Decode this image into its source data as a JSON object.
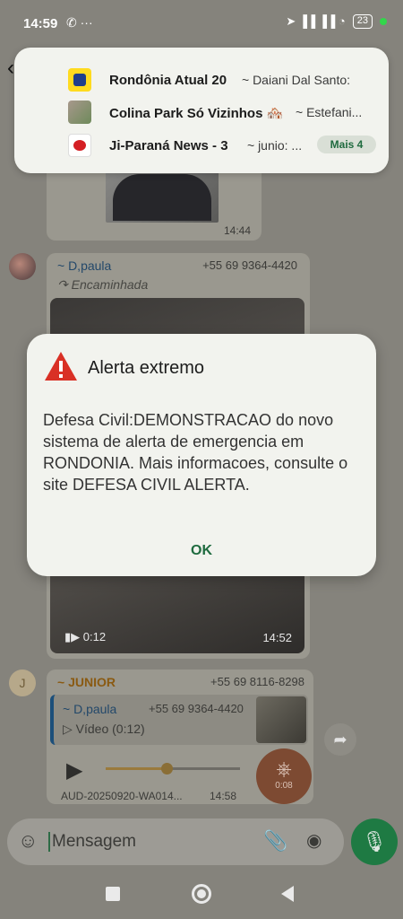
{
  "status_bar": {
    "time": "14:59",
    "left_icons": "✆ ···",
    "signal_icons": "➤ ▐▐ ▐▐ ◔",
    "battery": "23"
  },
  "notifications": [
    {
      "title": "Rondônia Atual  20",
      "snippet": "~ Daiani Dal Santo:"
    },
    {
      "title": "Colina Park Só Vizinhos 🏘️",
      "snippet": "~ Estefani..."
    },
    {
      "title": "Ji-Paraná News - 3",
      "snippet": "~ junio: ..."
    }
  ],
  "more_label": "Mais 4",
  "messages": {
    "image_time": "14:44",
    "video": {
      "sender": "~ D,paula",
      "phone": "+55 69 9364-4420",
      "forwarded": "↷ Encaminhada",
      "duration": "0:12",
      "time": "14:52"
    },
    "audio": {
      "avatar_letter": "J",
      "sender": "~ JUNIOR",
      "phone": "+55 69 8116-8298",
      "quote_name": "~ D,paula",
      "quote_phone": "+55 69 9364-4420",
      "quote_text": "Vídeo (0:12)",
      "filename": "AUD-20250920-WA014...",
      "time": "14:58",
      "playback_duration": "0:08",
      "progress": 0.45
    }
  },
  "input": {
    "placeholder": "Mensagem"
  },
  "alert": {
    "title": "Alerta extremo",
    "body": "Defesa Civil:DEMONSTRACAO do novo sistema de alerta de emergencia em RONDONIA. Mais informacoes, consulte o site DEFESA CIVIL ALERTA.",
    "ok": "OK"
  },
  "colors": {
    "accent_green": "#1f6b3f",
    "warning_red": "#d93025",
    "mic_green": "#1e7a43"
  }
}
